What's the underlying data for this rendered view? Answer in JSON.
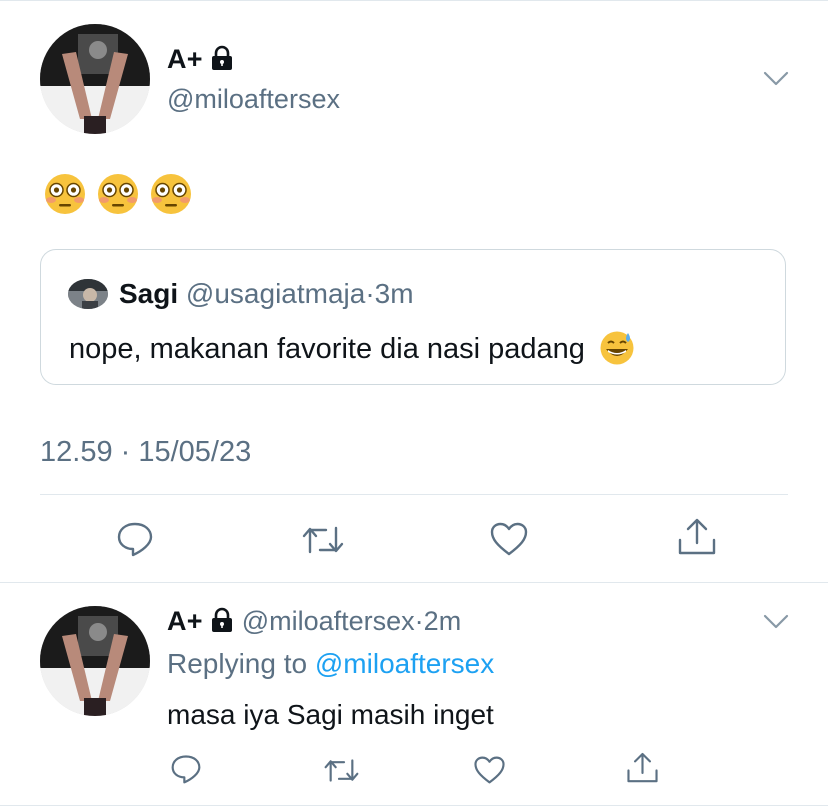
{
  "tweet": {
    "author_name": "A+",
    "author_handle": "@miloaftersex",
    "body_emojis": [
      "flushed-face",
      "flushed-face",
      "flushed-face"
    ],
    "quoted": {
      "author_name": "Sagi",
      "author_handle": "@usagiatmaja",
      "separator": "·",
      "time": "3m",
      "text": "nope, makanan favorite dia nasi padang",
      "emoji": "grinning-face-with-sweat"
    },
    "timestamp": "12.59 · 15/05/23"
  },
  "reply": {
    "author_name": "A+",
    "author_handle": "@miloaftersex",
    "separator": "·",
    "time": "2m",
    "replying_prefix": "Replying to ",
    "replying_to": "@miloaftersex",
    "text": "masa iya Sagi masih inget"
  },
  "actions": [
    "reply-icon",
    "retweet-icon",
    "like-icon",
    "share-icon"
  ],
  "colors": {
    "text": "#0f1419",
    "muted": "#5b7083",
    "link": "#1da1f2",
    "border": "#cfd9de"
  }
}
